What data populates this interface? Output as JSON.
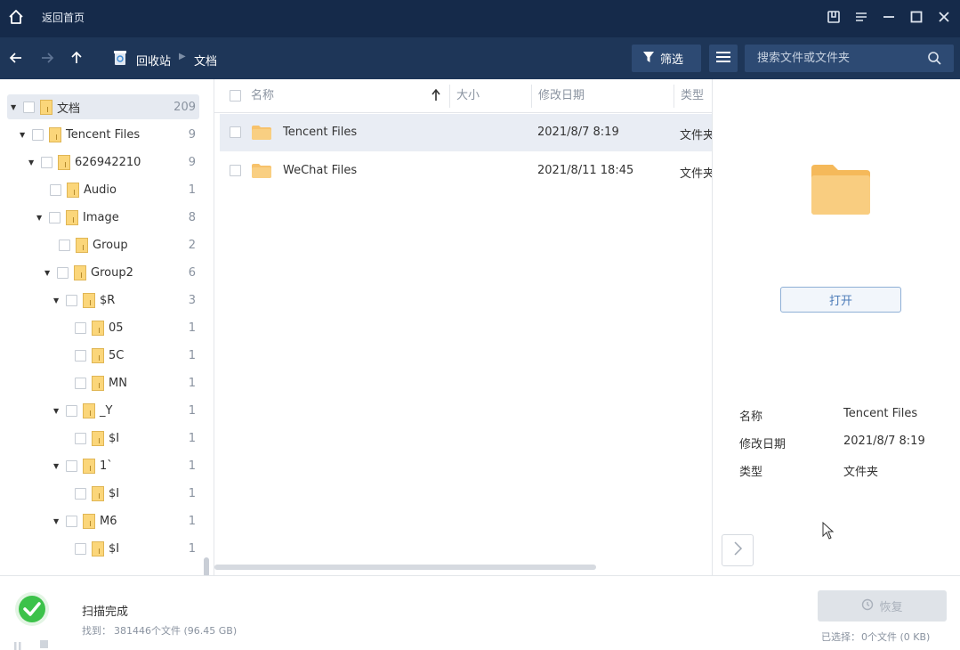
{
  "titlebar": {
    "back_home": "返回首页"
  },
  "breadcrumb": {
    "root": "回收站",
    "current": "文档"
  },
  "toolbar": {
    "filter_label": "筛选",
    "search_placeholder": "搜索文件或文件夹"
  },
  "tree": {
    "items": [
      {
        "label": "文档",
        "count": "209"
      },
      {
        "label": "Tencent Files",
        "count": "9"
      },
      {
        "label": "626942210",
        "count": "9"
      },
      {
        "label": "Audio",
        "count": "1"
      },
      {
        "label": "Image",
        "count": "8"
      },
      {
        "label": "Group",
        "count": "2"
      },
      {
        "label": "Group2",
        "count": "6"
      },
      {
        "label": "$R",
        "count": "3"
      },
      {
        "label": "05",
        "count": "1"
      },
      {
        "label": "5C",
        "count": "1"
      },
      {
        "label": "MN",
        "count": "1"
      },
      {
        "label": "_Y",
        "count": "1"
      },
      {
        "label": "$I",
        "count": "1"
      },
      {
        "label": "1`",
        "count": "1"
      },
      {
        "label": "$I",
        "count": "1"
      },
      {
        "label": "M6",
        "count": "1"
      },
      {
        "label": "$I",
        "count": "1"
      }
    ]
  },
  "list": {
    "headers": {
      "name": "名称",
      "size": "大小",
      "modified": "修改日期",
      "type": "类型"
    },
    "rows": [
      {
        "name": "Tencent Files",
        "date": "2021/8/7 8:19",
        "type": "文件夹"
      },
      {
        "name": "WeChat Files",
        "date": "2021/8/11 18:45",
        "type": "文件夹"
      }
    ]
  },
  "preview": {
    "open_label": "打开",
    "name_label": "名称",
    "name_value": "Tencent Files",
    "date_label": "修改日期",
    "date_value": "2021/8/7 8:19",
    "type_label": "类型",
    "type_value": "文件夹"
  },
  "footer": {
    "status": "扫描完成",
    "found_label": "找到：",
    "found_value": "381446个文件 (96.45 GB)",
    "recover_label": "恢复",
    "selected_label": "已选择：",
    "selected_value": "0个文件 (0 KB)"
  },
  "colors": {
    "titlebar": "#152a4a",
    "navbar": "#1e3658",
    "accent": "#4b7bb8",
    "success": "#3cc24a",
    "folder": "#f7c26b"
  }
}
